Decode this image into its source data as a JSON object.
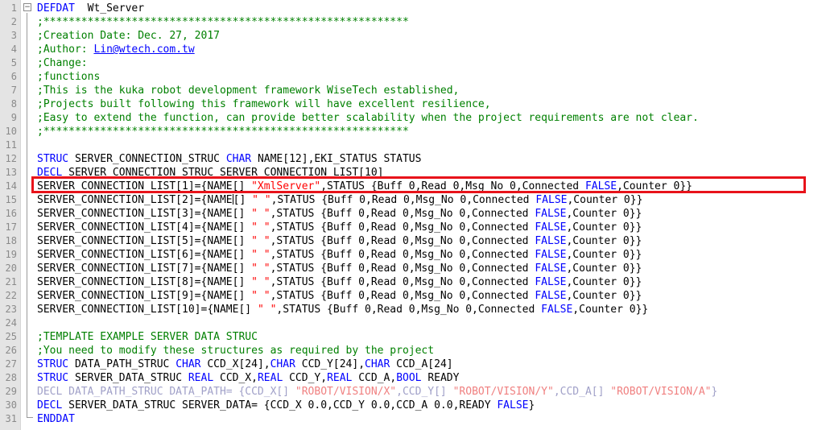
{
  "editor": {
    "lines": [
      {
        "n": "1",
        "t": [
          [
            "kw",
            "DEFDAT"
          ],
          [
            "",
            "  Wt_Server"
          ]
        ]
      },
      {
        "n": "2",
        "t": [
          [
            "cm",
            ";**********************************************************"
          ]
        ]
      },
      {
        "n": "3",
        "t": [
          [
            "cm",
            ";Creation Date: Dec. 27, 2017"
          ]
        ]
      },
      {
        "n": "4",
        "t": [
          [
            "cm",
            ";Author: "
          ],
          [
            "ul",
            "Lin@wtech.com.tw"
          ]
        ]
      },
      {
        "n": "5",
        "t": [
          [
            "cm",
            ";Change:"
          ]
        ]
      },
      {
        "n": "6",
        "t": [
          [
            "cm",
            ";functions"
          ]
        ]
      },
      {
        "n": "7",
        "t": [
          [
            "cm",
            ";This is the kuka robot development framework WiseTech established,"
          ]
        ]
      },
      {
        "n": "8",
        "t": [
          [
            "cm",
            ";Projects built following this framework will have excellent resilience,"
          ]
        ]
      },
      {
        "n": "9",
        "t": [
          [
            "cm",
            ";Easy to extend the function, can provide better scalability when the project requirements are not clear."
          ]
        ]
      },
      {
        "n": "10",
        "t": [
          [
            "cm",
            ";**********************************************************"
          ]
        ]
      },
      {
        "n": "11",
        "t": []
      },
      {
        "n": "12",
        "t": [
          [
            "kw",
            "STRUC"
          ],
          [
            "",
            " SERVER_CONNECTION_STRUC "
          ],
          [
            "kw",
            "CHAR"
          ],
          [
            "",
            " NAME[12],EKI_STATUS STATUS"
          ]
        ]
      },
      {
        "n": "13",
        "t": [
          [
            "kw",
            "DECL"
          ],
          [
            "",
            " SERVER_CONNECTION_STRUC SERVER_CONNECTION_LIST[10]"
          ]
        ]
      },
      {
        "n": "14",
        "t": [
          [
            "",
            "SERVER_CONNECTION_LIST[1]={NAME[] "
          ],
          [
            "str",
            "\"XmlServer\""
          ],
          [
            "",
            ",STATUS {Buff 0,Read 0,Msg_No 0,Connected "
          ],
          [
            "kw",
            "FALSE"
          ],
          [
            "",
            ",Counter 0}}"
          ]
        ]
      },
      {
        "n": "15",
        "t": [
          [
            "",
            "SERVER_CONNECTION_LIST[2]={NAME"
          ],
          [
            "caret",
            ""
          ],
          [
            "",
            "[] "
          ],
          [
            "str",
            "\" \""
          ],
          [
            "",
            ",STATUS {Buff 0,Read 0,Msg_No 0,Connected "
          ],
          [
            "kw",
            "FALSE"
          ],
          [
            "",
            ",Counter 0}}"
          ]
        ]
      },
      {
        "n": "16",
        "t": [
          [
            "",
            "SERVER_CONNECTION_LIST[3]={NAME[] "
          ],
          [
            "str",
            "\" \""
          ],
          [
            "",
            ",STATUS {Buff 0,Read 0,Msg_No 0,Connected "
          ],
          [
            "kw",
            "FALSE"
          ],
          [
            "",
            ",Counter 0}}"
          ]
        ]
      },
      {
        "n": "17",
        "t": [
          [
            "",
            "SERVER_CONNECTION_LIST[4]={NAME[] "
          ],
          [
            "str",
            "\" \""
          ],
          [
            "",
            ",STATUS {Buff 0,Read 0,Msg_No 0,Connected "
          ],
          [
            "kw",
            "FALSE"
          ],
          [
            "",
            ",Counter 0}}"
          ]
        ]
      },
      {
        "n": "18",
        "t": [
          [
            "",
            "SERVER_CONNECTION_LIST[5]={NAME[] "
          ],
          [
            "str",
            "\" \""
          ],
          [
            "",
            ",STATUS {Buff 0,Read 0,Msg_No 0,Connected "
          ],
          [
            "kw",
            "FALSE"
          ],
          [
            "",
            ",Counter 0}}"
          ]
        ]
      },
      {
        "n": "19",
        "t": [
          [
            "",
            "SERVER_CONNECTION_LIST[6]={NAME[] "
          ],
          [
            "str",
            "\" \""
          ],
          [
            "",
            ",STATUS {Buff 0,Read 0,Msg_No 0,Connected "
          ],
          [
            "kw",
            "FALSE"
          ],
          [
            "",
            ",Counter 0}}"
          ]
        ]
      },
      {
        "n": "20",
        "t": [
          [
            "",
            "SERVER_CONNECTION_LIST[7]={NAME[] "
          ],
          [
            "str",
            "\" \""
          ],
          [
            "",
            ",STATUS {Buff 0,Read 0,Msg_No 0,Connected "
          ],
          [
            "kw",
            "FALSE"
          ],
          [
            "",
            ",Counter 0}}"
          ]
        ]
      },
      {
        "n": "21",
        "t": [
          [
            "",
            "SERVER_CONNECTION_LIST[8]={NAME[] "
          ],
          [
            "str",
            "\" \""
          ],
          [
            "",
            ",STATUS {Buff 0,Read 0,Msg_No 0,Connected "
          ],
          [
            "kw",
            "FALSE"
          ],
          [
            "",
            ",Counter 0}}"
          ]
        ]
      },
      {
        "n": "22",
        "t": [
          [
            "",
            "SERVER_CONNECTION_LIST[9]={NAME[] "
          ],
          [
            "str",
            "\" \""
          ],
          [
            "",
            ",STATUS {Buff 0,Read 0,Msg_No 0,Connected "
          ],
          [
            "kw",
            "FALSE"
          ],
          [
            "",
            ",Counter 0}}"
          ]
        ]
      },
      {
        "n": "23",
        "t": [
          [
            "",
            "SERVER_CONNECTION_LIST[10]={NAME[] "
          ],
          [
            "str",
            "\" \""
          ],
          [
            "",
            ",STATUS {Buff 0,Read 0,Msg_No 0,Connected "
          ],
          [
            "kw",
            "FALSE"
          ],
          [
            "",
            ",Counter 0}}"
          ]
        ]
      },
      {
        "n": "24",
        "t": []
      },
      {
        "n": "25",
        "t": [
          [
            "cm",
            ";TEMPLATE EXAMPLE SERVER DATA STRUC"
          ]
        ]
      },
      {
        "n": "26",
        "t": [
          [
            "cm",
            ";You need to modify these structures as required by the project"
          ]
        ]
      },
      {
        "n": "27",
        "t": [
          [
            "kw",
            "STRUC"
          ],
          [
            "",
            " DATA_PATH_STRUC "
          ],
          [
            "kw",
            "CHAR"
          ],
          [
            "",
            " CCD_X[24],"
          ],
          [
            "kw",
            "CHAR"
          ],
          [
            "",
            " CCD_Y[24],"
          ],
          [
            "kw",
            "CHAR"
          ],
          [
            "",
            " CCD_A[24]"
          ]
        ]
      },
      {
        "n": "28",
        "t": [
          [
            "kw",
            "STRUC"
          ],
          [
            "",
            " SERVER_DATA_STRUC "
          ],
          [
            "kw",
            "REAL"
          ],
          [
            "",
            " CCD_X,"
          ],
          [
            "kw",
            "REAL"
          ],
          [
            "",
            " CCD_Y,"
          ],
          [
            "kw",
            "REAL"
          ],
          [
            "",
            " CCD_A,"
          ],
          [
            "kw",
            "BOOL"
          ],
          [
            "",
            " READY"
          ]
        ]
      },
      {
        "n": "29",
        "t": [
          [
            "dim",
            "DECL DATA_PATH_STRUC DATA_PATH= {CCD_X[] "
          ],
          [
            "dimstr",
            "\"ROBOT/VISION/X\""
          ],
          [
            "dim",
            ",CCD_Y[] "
          ],
          [
            "dimstr",
            "\"ROBOT/VISION/Y\""
          ],
          [
            "dim",
            ",CCD_A[] "
          ],
          [
            "dimstr",
            "\"ROBOT/VISION/A\""
          ],
          [
            "dim",
            "}"
          ]
        ]
      },
      {
        "n": "30",
        "t": [
          [
            "kw",
            "DECL"
          ],
          [
            "",
            " SERVER_DATA_STRUC SERVER_DATA= {CCD_X 0.0,CCD_Y 0.0,CCD_A 0.0,READY "
          ],
          [
            "kw",
            "FALSE"
          ],
          [
            "",
            "}"
          ]
        ]
      },
      {
        "n": "31",
        "t": [
          [
            "kw",
            "ENDDAT"
          ]
        ]
      }
    ]
  },
  "fold": {
    "collapse_symbol": "−"
  },
  "colors": {
    "keyword": "#0000ff",
    "comment": "#008000",
    "string": "#ff0000",
    "highlight_box": "#e8131a"
  }
}
